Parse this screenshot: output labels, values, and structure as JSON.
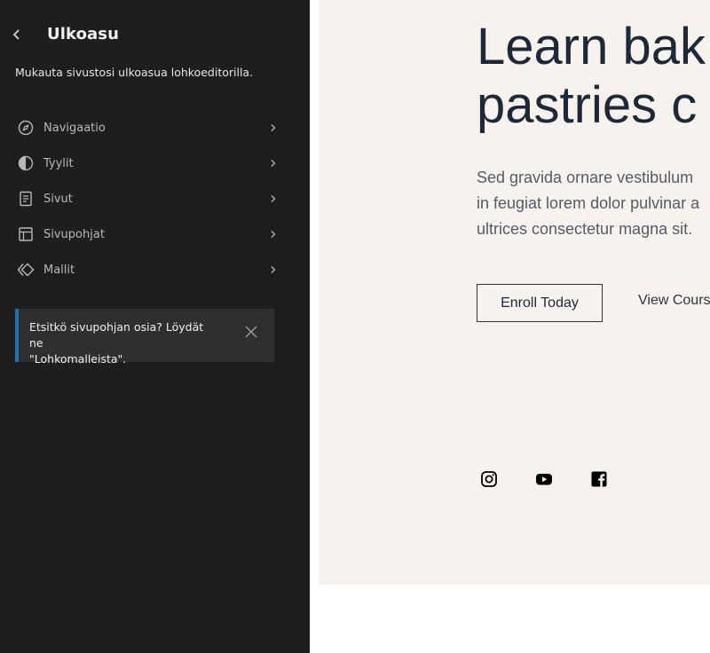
{
  "sidebar": {
    "title": "Ulkoasu",
    "description": "Mukauta sivustosi ulkoasua lohkoeditorilla.",
    "items": [
      {
        "label": "Navigaatio",
        "icon": "compass-icon"
      },
      {
        "label": "Tyylit",
        "icon": "half-circle-icon"
      },
      {
        "label": "Sivut",
        "icon": "page-icon"
      },
      {
        "label": "Sivupohjat",
        "icon": "layout-icon"
      },
      {
        "label": "Mallit",
        "icon": "symbol-icon"
      }
    ],
    "notice": {
      "text_line1": "Etsitkö sivupohjan osia? Löydät ne",
      "text_line2": "\"Lohkomalleista\"."
    }
  },
  "preview": {
    "title_line1": "Learn bak",
    "title_line2": "pastries c",
    "text_line1": "Sed gravida ornare vestibulum",
    "text_line2": "in feugiat lorem dolor pulvinar a",
    "text_line3": "ultrices consectetur magna sit.",
    "enroll_label": "Enroll Today",
    "view_label": "View Cours",
    "social": [
      "instagram-icon",
      "youtube-icon",
      "facebook-icon"
    ]
  },
  "colors": {
    "sidebar_bg": "#1e1e1e",
    "notice_bg": "#2f2f2f",
    "notice_accent": "#2271b1",
    "hero_bg": "#f8f2ee",
    "heading": "#1d2839"
  }
}
